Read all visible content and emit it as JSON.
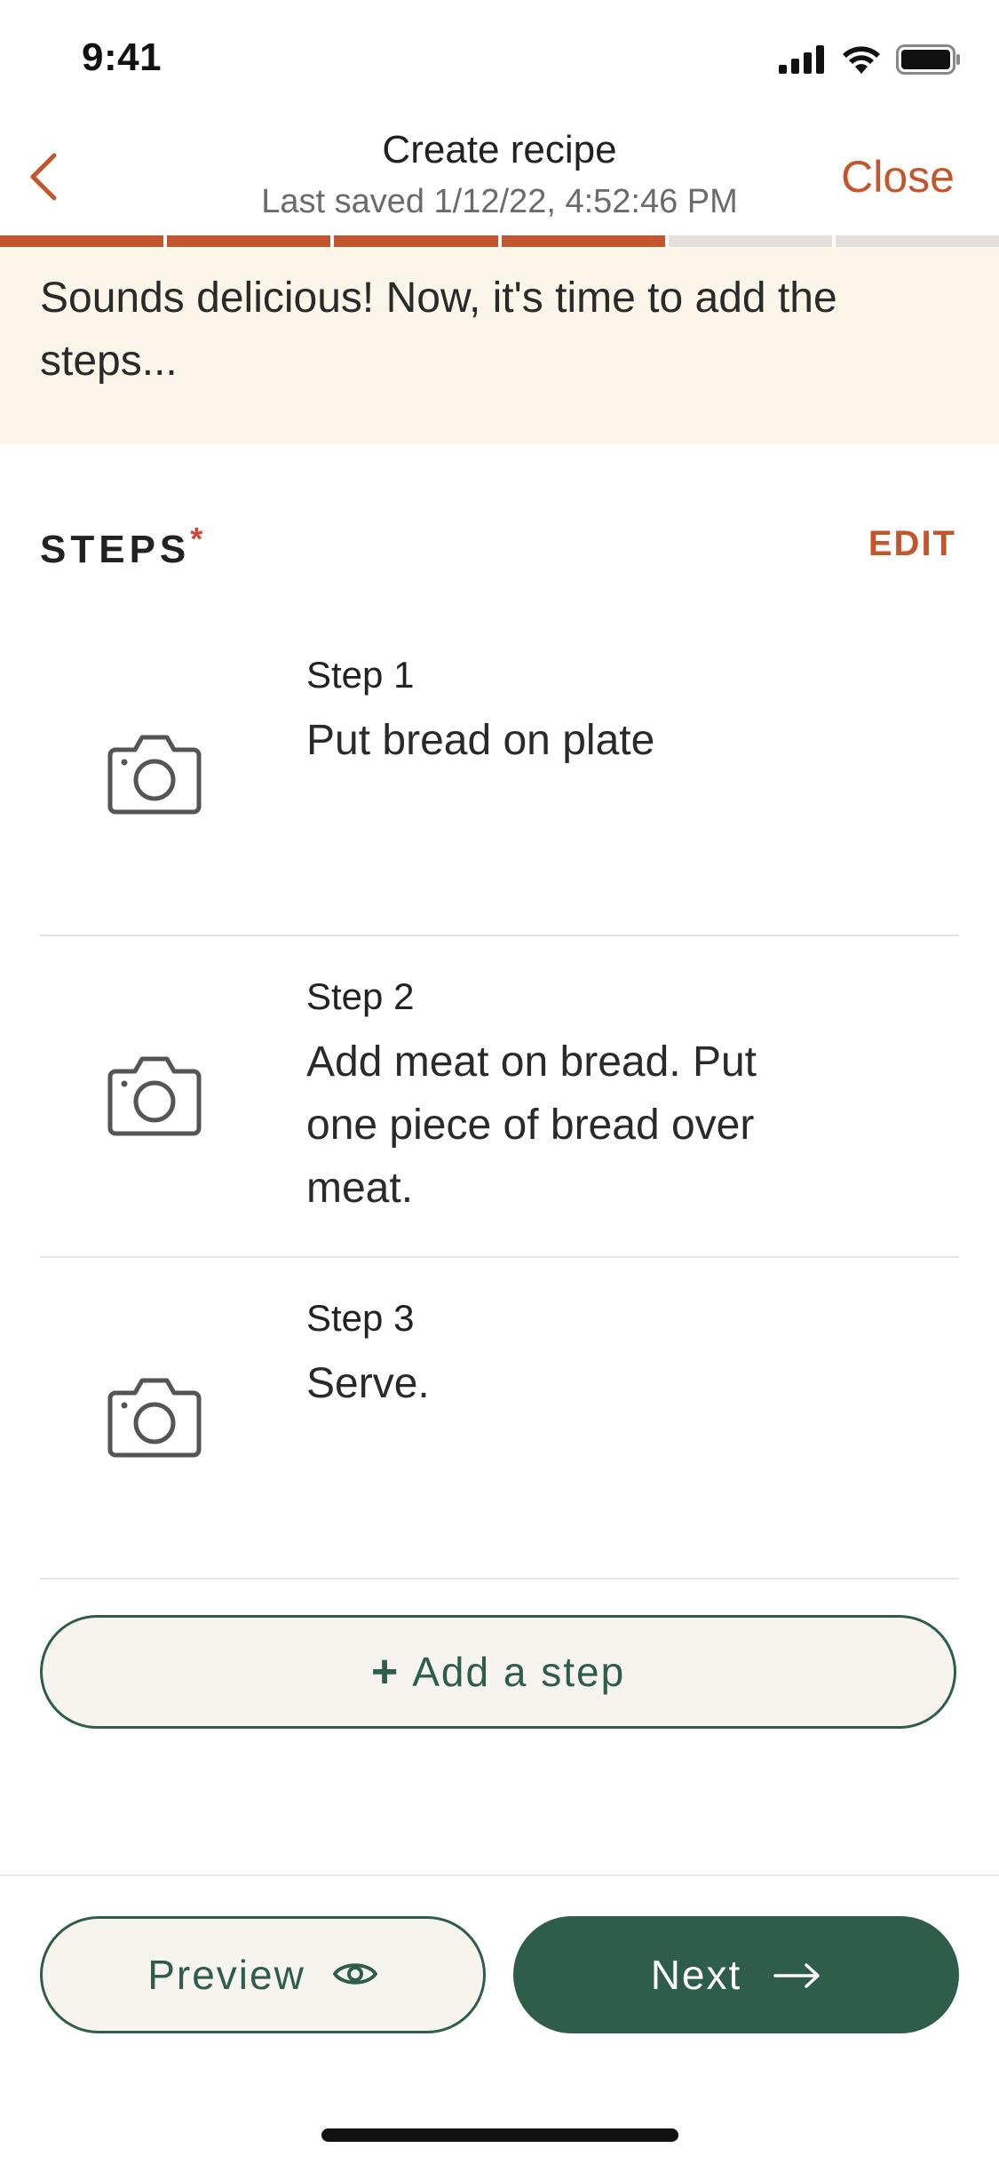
{
  "status_bar": {
    "time": "9:41"
  },
  "header": {
    "title": "Create recipe",
    "subtitle": "Last saved 1/12/22, 4:52:46 PM",
    "close_label": "Close"
  },
  "progress": {
    "total_segments": 6,
    "completed_segments": 4
  },
  "banner": {
    "text": "Sounds delicious! Now, it's time to add the steps..."
  },
  "steps_section": {
    "heading": "STEPS",
    "required_marker": "*",
    "edit_label": "EDIT",
    "steps": [
      {
        "label": "Step 1",
        "text": "Put bread on plate"
      },
      {
        "label": "Step 2",
        "text": "Add meat on bread. Put one piece of bread over meat."
      },
      {
        "label": "Step 3",
        "text": "Serve."
      }
    ]
  },
  "add_step": {
    "plus": "+",
    "label": "Add a step"
  },
  "footer": {
    "preview_label": "Preview",
    "next_label": "Next"
  },
  "colors": {
    "accent": "#c4552d",
    "primary": "#2e5e4a",
    "banner_bg": "#fbf5ea",
    "progress_track": "#e4e0dc"
  },
  "icons": {
    "back": "chevron-left-icon",
    "photo": "camera-icon",
    "preview": "eye-icon",
    "next": "arrow-right-icon"
  }
}
